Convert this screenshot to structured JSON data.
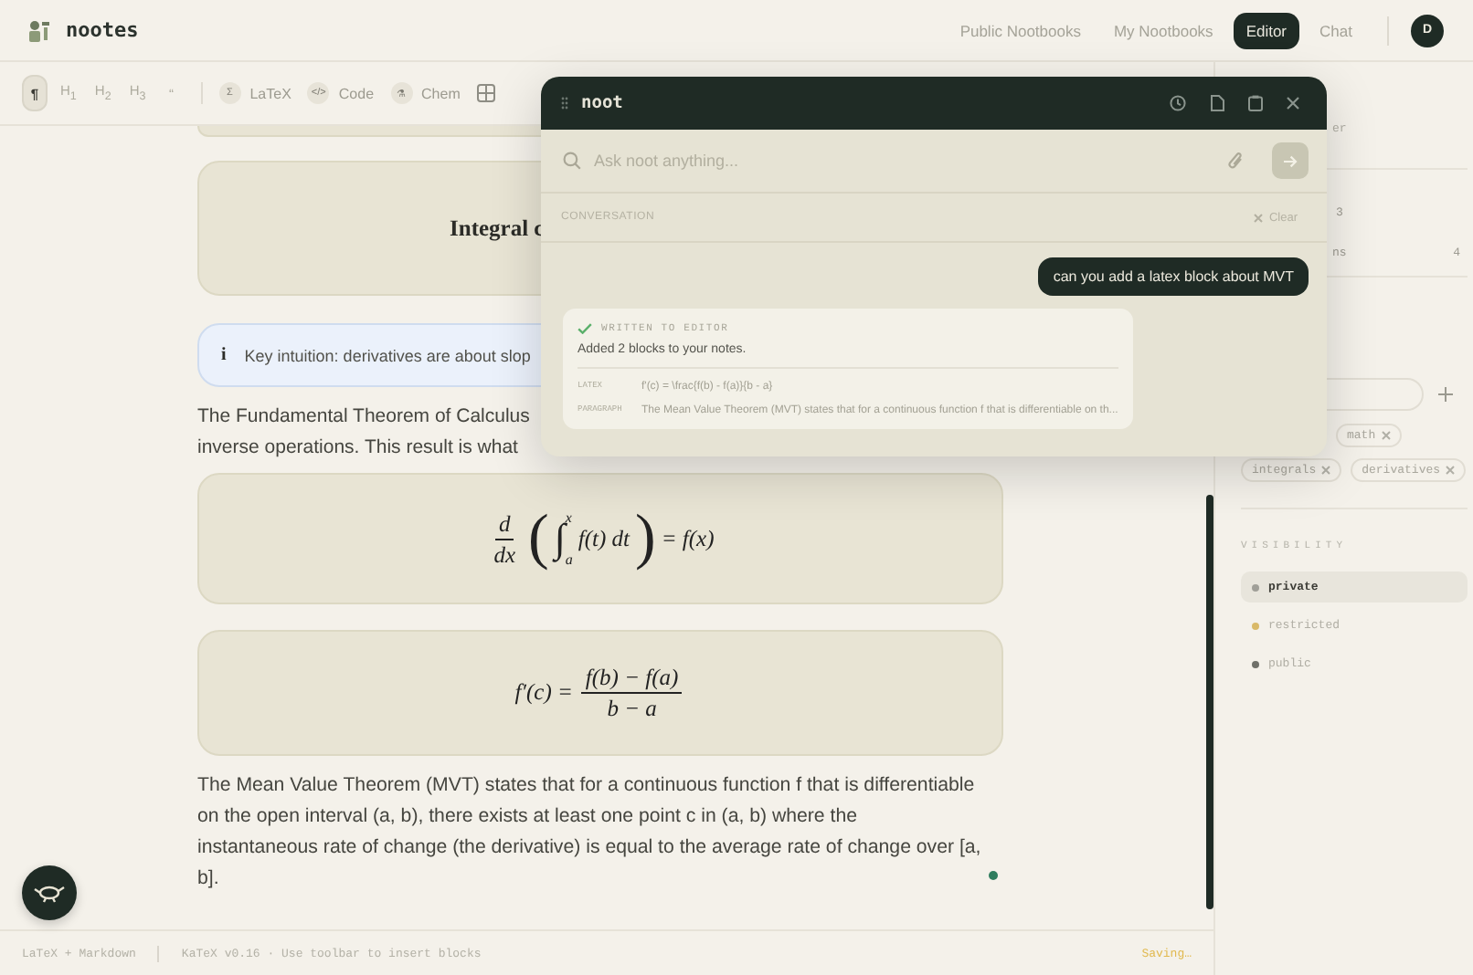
{
  "header": {
    "logo": "nootes",
    "nav": [
      {
        "label": "Public Nootbooks",
        "selected": false
      },
      {
        "label": "My Nootbooks",
        "selected": false
      },
      {
        "label": "Editor",
        "selected": true
      },
      {
        "label": "Chat",
        "selected": false
      }
    ],
    "avatar": "D"
  },
  "toolbar": {
    "formats": [
      {
        "label": "¶",
        "selected": true
      },
      {
        "label": "H$_{1}$",
        "selected": false
      },
      {
        "label": "H$_{2}$",
        "selected": false
      },
      {
        "label": "H$_{3}$",
        "selected": false
      },
      {
        "label": "“",
        "selected": false
      }
    ],
    "inserts": [
      {
        "icon": "Σ",
        "label": "LaTeX"
      },
      {
        "icon": "</>",
        "label": "Code"
      },
      {
        "icon": "⚗",
        "label": "Chem"
      }
    ]
  },
  "editor": {
    "blocks": [
      {
        "kind": "peek"
      },
      {
        "kind": "heading-card",
        "text": "Integral c"
      },
      {
        "kind": "callout",
        "icon": "i",
        "text": "Key intuition: derivatives are about slop"
      },
      {
        "kind": "cut-paragraph",
        "lines": [
          "The Fundamental Theorem of Calculus",
          "inverse operations. This result is what"
        ]
      },
      {
        "kind": "ftc",
        "num": "d",
        "den": "dx",
        "open": "(",
        "integral": "∫",
        "upper": "x",
        "lower": "a",
        "integrand": "f(t) dt",
        "close": ")",
        "rhs": "= f(x)"
      },
      {
        "kind": "mvt",
        "lhs": "f′(c) =",
        "num": "f(b) − f(a)",
        "den": "b − a"
      },
      {
        "kind": "paragraph",
        "text": "The Mean Value Theorem (MVT) states that for a continuous function f that is differentiable on the open interval (a, b), there exists at least one point c in (a, b) where the instantaneous rate of change (the derivative) is equal to the average rate of change over [a, b]."
      }
    ]
  },
  "footer": {
    "items": [
      "LaTeX + Markdown",
      "KaTeX v0.16 · Use toolbar to insert blocks"
    ],
    "status": "Saving…"
  },
  "sidebar": {
    "fragment": "er",
    "stats": [
      {
        "kind": "inline",
        "value": "3"
      },
      {
        "kind": "split",
        "label": "ns",
        "value": "4"
      }
    ],
    "tags": [
      {
        "label": "math"
      },
      {
        "label": "integrals"
      },
      {
        "label": "derivatives"
      }
    ],
    "visibility": {
      "title": "VISIBILITY",
      "options": [
        {
          "label": "private",
          "selected": true,
          "color": "#a09f98"
        },
        {
          "label": "restricted",
          "selected": false,
          "color": "#d9b968"
        },
        {
          "label": "public",
          "selected": false,
          "color": "#6f7069"
        }
      ]
    }
  },
  "chat": {
    "title": "noot",
    "placeholder": "Ask noot anything...",
    "section": "CONVERSATION",
    "clear": "Clear",
    "messages": [
      {
        "kind": "user",
        "text": "can you add a latex block about MVT"
      },
      {
        "kind": "result",
        "status": "WRITTEN TO EDITOR",
        "summary": "Added 2 blocks to your notes.",
        "blocks": [
          {
            "type": "LATEX",
            "content": "f'(c) = \\frac{f(b) - f(a)}{b - a}"
          },
          {
            "type": "PARAGRAPH",
            "content": "The Mean Value Theorem (MVT) states that for a continuous function f that is differentiable on th..."
          }
        ]
      }
    ]
  }
}
